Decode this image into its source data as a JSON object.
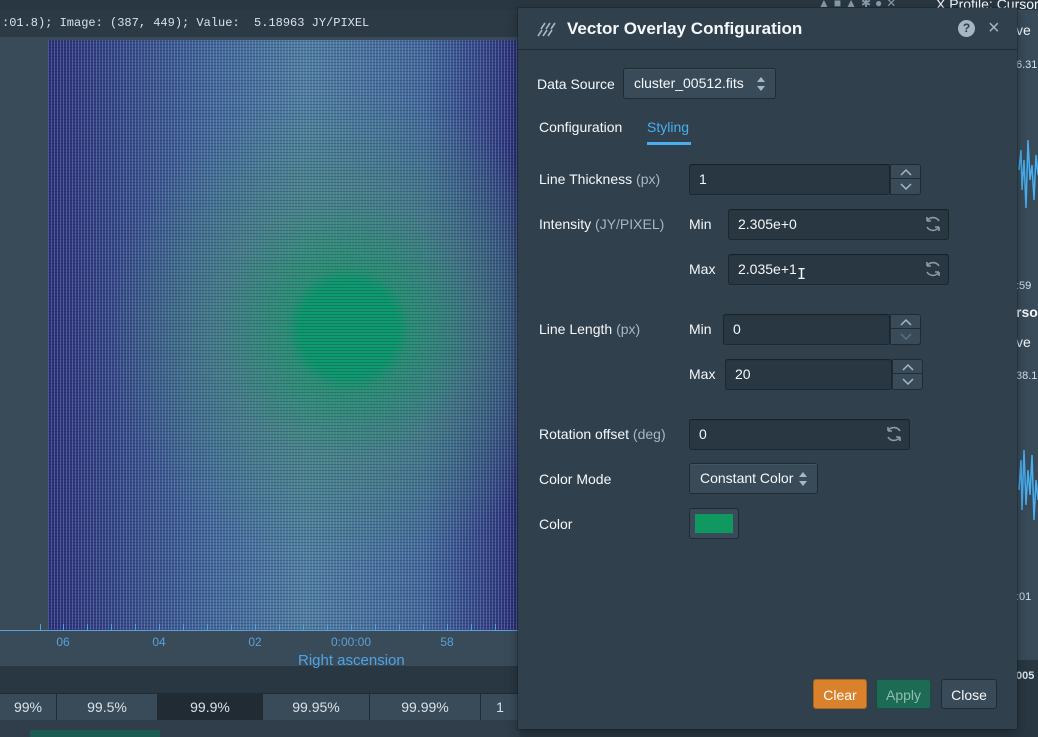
{
  "background": {
    "cursor_info": ":01.8); Image: (387, 449); Value:  5.18963 JY/PIXEL",
    "axis_ticks": [
      "06",
      "04",
      "02",
      "0:00:00",
      "58"
    ],
    "axis_title": "Right ascension",
    "percentiles": [
      "99%",
      "99.5%",
      "99.9%",
      "99.95%",
      "99.99%",
      "1"
    ],
    "active_percentile": "99.9%",
    "right_panel": {
      "title": "X Profile: Cursor",
      "save_btn_1": "ve",
      "value_1": "6.31",
      "coord_1": ":59",
      "title_2": "rsor",
      "save_btn_2": "ve",
      "value_2": "38.1",
      "coord_2": ":01",
      "label_3": "005"
    }
  },
  "dialog": {
    "title": "Vector Overlay Configuration",
    "help_label": "?",
    "close_label": "×",
    "data_source": {
      "label": "Data Source",
      "value": "cluster_00512.fits"
    },
    "tabs": [
      {
        "label": "Configuration",
        "active": false
      },
      {
        "label": "Styling",
        "active": true
      }
    ],
    "line_thickness": {
      "label": "Line Thickness",
      "unit": "(px)",
      "value": "1"
    },
    "intensity": {
      "label": "Intensity",
      "unit": "(JY/PIXEL)",
      "min_label": "Min",
      "min_value": "2.305e+0",
      "max_label": "Max",
      "max_value": "2.035e+1"
    },
    "line_length": {
      "label": "Line Length",
      "unit": "(px)",
      "min_label": "Min",
      "min_value": "0",
      "max_label": "Max",
      "max_value": "20"
    },
    "rotation_offset": {
      "label": "Rotation offset",
      "unit": "(deg)",
      "value": "0"
    },
    "color_mode": {
      "label": "Color Mode",
      "value": "Constant Color"
    },
    "color": {
      "label": "Color",
      "swatch": "#0f9960"
    },
    "footer": {
      "clear": "Clear",
      "apply": "Apply",
      "close": "Close"
    }
  }
}
